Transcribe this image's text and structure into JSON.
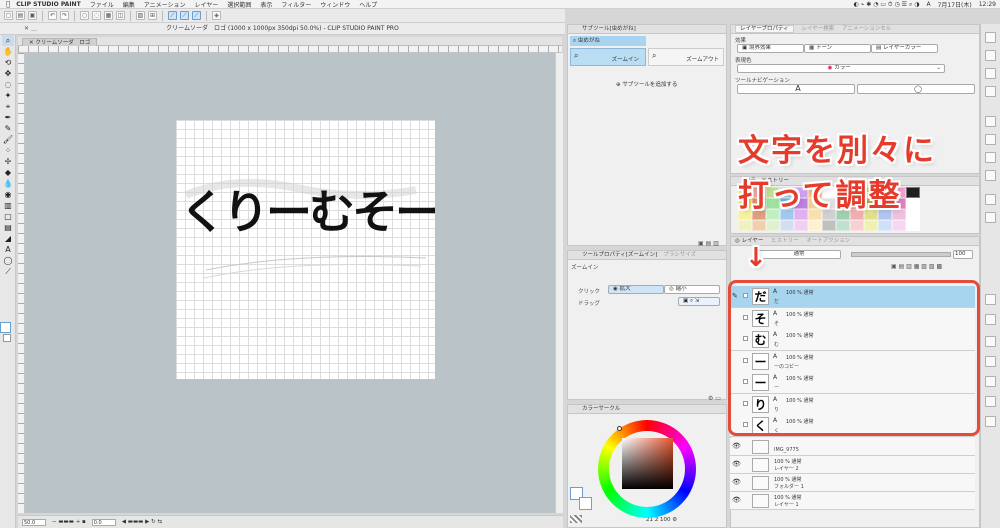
{
  "menubar": {
    "app_name": "CLIP STUDIO PAINT",
    "items": [
      "ファイル",
      "編集",
      "アニメーション",
      "レイヤー",
      "選択範囲",
      "表示",
      "フィルター",
      "ウィンドウ",
      "ヘルプ"
    ],
    "right_items": [
      "A",
      "7月17日(木)",
      "12:29"
    ]
  },
  "window": {
    "title": "クリームソーダ　ロゴ (1000 x 1000px 350dpi 50.0%)  - CLIP STUDIO PAINT PRO",
    "doc_tab": "クリームソーダ　ロゴ"
  },
  "canvas": {
    "logo_text": "くりーむそーだ"
  },
  "status": {
    "zoom": "50.0",
    "angle": "0.0"
  },
  "subtool_panel": {
    "title": "サブツール[虫めがね]",
    "search_label": "虫めがね",
    "zoom_in": "ズームイン",
    "zoom_out": "ズームアウト",
    "add_subtool": "サブツールを追加する"
  },
  "tool_property": {
    "title": "ツールプロパティ[ズームイン]",
    "brush_size_tab": "ブラシサイズ",
    "heading": "ズームイン",
    "click_label": "クリック",
    "zoom_in_opt": "拡大",
    "zoom_out_opt": "縮小",
    "drag_label": "ドラッグ"
  },
  "color_panel": {
    "title": "カラーサークル",
    "readout": "21",
    "readout2": "2",
    "readout3": "100",
    "colors": {
      "main": "#ffffff",
      "hue": "#e6552f"
    }
  },
  "layer_property": {
    "tab1": "レイヤープロパティ",
    "tab2": "レイヤー検索",
    "tab3": "アニメーションセル",
    "effect_label": "効果",
    "border_effect": "境界効果",
    "tone": "トーン",
    "layer_color": "レイヤーカラー",
    "expression_label": "表現色",
    "color_mode": "カラー",
    "tool_nav_label": "ツールナビゲーション",
    "tool_nav_btn": "A"
  },
  "color_history": {
    "title": "カラーヒストリー",
    "swatches": [
      "#e8e878",
      "#f4a0a0",
      "#c0e090",
      "#a0d0f0",
      "#d0a0f0",
      "#f0c080",
      "#ffffff",
      "#80c0a0",
      "#f09090",
      "#d0d060",
      "#90b0f0",
      "#f0a0d0",
      "#202020",
      "#f0e060",
      "#e09060",
      "#a0e0a0",
      "#70b0e0",
      "#c080e0",
      "#f0d090",
      "#e0e0e0",
      "#60a080",
      "#e07070",
      "#b0b040",
      "#7090e0",
      "#e080c0",
      "#ffffff",
      "#f8f0a0",
      "#e0a080",
      "#c0f0c0",
      "#a0c8f0",
      "#e0b0f0",
      "#f8e0b0",
      "#d0d0d0",
      "#a0d0b0",
      "#f0b0b0",
      "#e0e090",
      "#b0c8f0",
      "#f0c0e0",
      "#ffffff",
      "#f0f0c0",
      "#f0d0b0",
      "#e0f0d0",
      "#d0e0f0",
      "#f0d0f0",
      "#fff0d0",
      "#c0c0c0",
      "#c0e0d0",
      "#f8d0d0",
      "#f0f0b0",
      "#d0e0f8",
      "#f8d8f0",
      "#ffffff"
    ]
  },
  "layer_panel": {
    "tabs": [
      "レイヤー",
      "ヒストリー",
      "オートアクション"
    ],
    "blend_mode": "通常",
    "opacity": "100",
    "layers": [
      {
        "glyph": "だ",
        "pct": "100 % 通常",
        "name": "だ"
      },
      {
        "glyph": "そ",
        "pct": "100 % 通常",
        "name": "そ"
      },
      {
        "glyph": "む",
        "pct": "100 % 通常",
        "name": "む"
      },
      {
        "glyph": "ー",
        "pct": "100 % 通常",
        "name": "ーのコピー"
      },
      {
        "glyph": "ー",
        "pct": "100 % 通常",
        "name": "ー"
      },
      {
        "glyph": "り",
        "pct": "100 % 通常",
        "name": "り"
      },
      {
        "glyph": "く",
        "pct": "100 % 通常",
        "name": "く"
      }
    ],
    "lower_layers": [
      {
        "pct": "",
        "name": "IMG_9775"
      },
      {
        "pct": "100 % 通常",
        "name": "レイヤー 2"
      },
      {
        "pct": "100 % 通常",
        "name": "フォルダー 1"
      },
      {
        "pct": "100 % 通常",
        "name": "レイヤー 1"
      }
    ]
  },
  "annotation": {
    "line1": "文字を別々に",
    "line2": "打って調整",
    "arrow": "↓",
    "color": "#e63a2a"
  }
}
